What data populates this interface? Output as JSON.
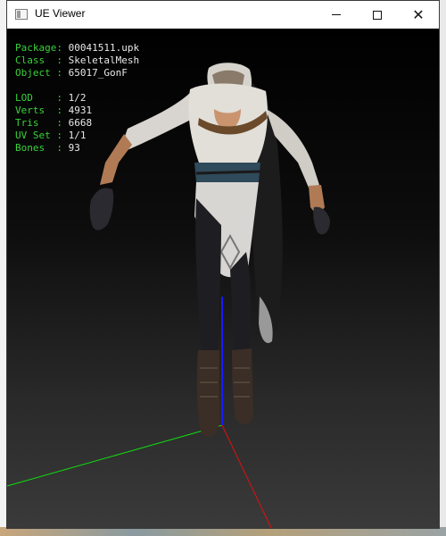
{
  "window": {
    "title": "UE Viewer",
    "controls": {
      "minimize": "minimize-icon",
      "maximize": "maximize-icon",
      "close": "close-icon"
    }
  },
  "info": {
    "package": {
      "label": "Package",
      "value": "00041511.upk"
    },
    "class": {
      "label": "Class  ",
      "value": "SkeletalMesh"
    },
    "object": {
      "label": "Object ",
      "value": "65017_GonF"
    },
    "lod": {
      "label": "LOD    ",
      "value": "1/2"
    },
    "verts": {
      "label": "Verts  ",
      "value": "4931"
    },
    "tris": {
      "label": "Tris   ",
      "value": "6668"
    },
    "uvset": {
      "label": "UV Set ",
      "value": "1/1"
    },
    "bones": {
      "label": "Bones  ",
      "value": "93"
    }
  },
  "colors": {
    "label": "#3ad23a",
    "axis_x": "#e01010",
    "axis_y": "#10e010",
    "axis_z": "#1a1aff"
  }
}
